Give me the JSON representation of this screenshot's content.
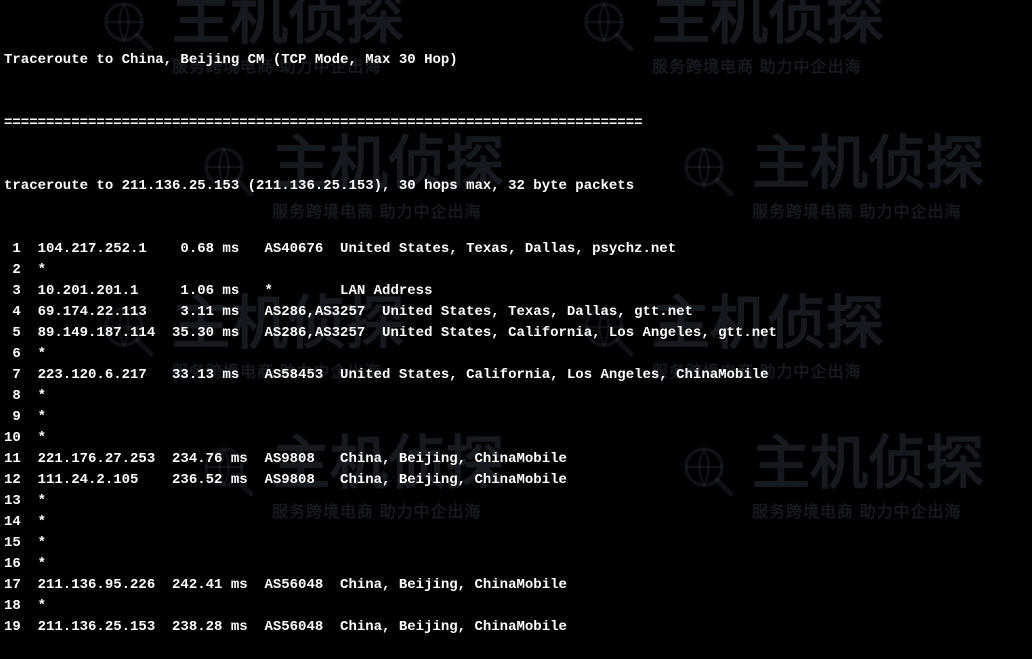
{
  "header": {
    "title": "Traceroute to China, Beijing CM (TCP Mode, Max 30 Hop)",
    "separator": "============================================================================",
    "cmdline": "traceroute to 211.136.25.153 (211.136.25.153), 30 hops max, 32 byte packets"
  },
  "hops": [
    {
      "n": " 1",
      "ip": "104.217.252.1",
      "rtt": "  0.68 ms",
      "asn": "AS40676",
      "loc": "United States, Texas, Dallas, psychz.net"
    },
    {
      "n": " 2",
      "ip": "*",
      "rtt": "",
      "asn": "",
      "loc": ""
    },
    {
      "n": " 3",
      "ip": "10.201.201.1",
      "rtt": "  1.06 ms",
      "asn": "*",
      "loc": "LAN Address"
    },
    {
      "n": " 4",
      "ip": "69.174.22.113",
      "rtt": "  3.11 ms",
      "asn": "AS286,AS3257",
      "loc": "United States, Texas, Dallas, gtt.net"
    },
    {
      "n": " 5",
      "ip": "89.149.187.114",
      "rtt": " 35.30 ms",
      "asn": "AS286,AS3257",
      "loc": "United States, California, Los Angeles, gtt.net"
    },
    {
      "n": " 6",
      "ip": "*",
      "rtt": "",
      "asn": "",
      "loc": ""
    },
    {
      "n": " 7",
      "ip": "223.120.6.217",
      "rtt": " 33.13 ms",
      "asn": "AS58453",
      "loc": "United States, California, Los Angeles, ChinaMobile"
    },
    {
      "n": " 8",
      "ip": "*",
      "rtt": "",
      "asn": "",
      "loc": ""
    },
    {
      "n": " 9",
      "ip": "*",
      "rtt": "",
      "asn": "",
      "loc": ""
    },
    {
      "n": "10",
      "ip": "*",
      "rtt": "",
      "asn": "",
      "loc": ""
    },
    {
      "n": "11",
      "ip": "221.176.27.253",
      "rtt": " 234.76 ms",
      "asn": "AS9808",
      "loc": "China, Beijing, ChinaMobile"
    },
    {
      "n": "12",
      "ip": "111.24.2.105",
      "rtt": " 236.52 ms",
      "asn": "AS9808",
      "loc": "China, Beijing, ChinaMobile"
    },
    {
      "n": "13",
      "ip": "*",
      "rtt": "",
      "asn": "",
      "loc": ""
    },
    {
      "n": "14",
      "ip": "*",
      "rtt": "",
      "asn": "",
      "loc": ""
    },
    {
      "n": "15",
      "ip": "*",
      "rtt": "",
      "asn": "",
      "loc": ""
    },
    {
      "n": "16",
      "ip": "*",
      "rtt": "",
      "asn": "",
      "loc": ""
    },
    {
      "n": "17",
      "ip": "211.136.95.226",
      "rtt": " 242.41 ms",
      "asn": "AS56048",
      "loc": "China, Beijing, ChinaMobile"
    },
    {
      "n": "18",
      "ip": "*",
      "rtt": "",
      "asn": "",
      "loc": ""
    },
    {
      "n": "19",
      "ip": "211.136.25.153",
      "rtt": " 238.28 ms",
      "asn": "AS56048",
      "loc": "China, Beijing, ChinaMobile"
    }
  ],
  "watermark": {
    "main": "主机侦探",
    "sub": "服务跨境电商 助力中企出海"
  }
}
